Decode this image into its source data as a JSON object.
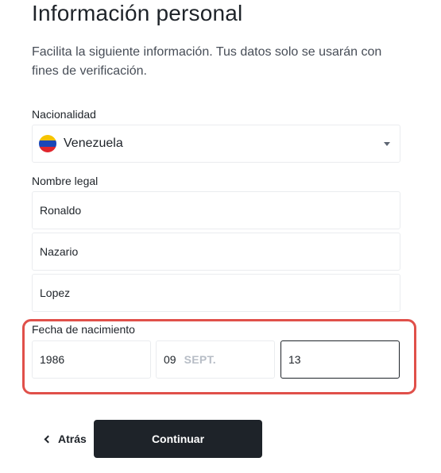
{
  "title": "Información personal",
  "subtitle": "Facilita la siguiente información. Tus datos solo se usarán con fines de verificación.",
  "nationality": {
    "label": "Nacionalidad",
    "value": "Venezuela",
    "flag_icon": "venezuela-flag-icon",
    "dropdown_icon": "caret-down-icon"
  },
  "legal_name": {
    "label": "Nombre legal",
    "first_name": "Ronaldo",
    "middle_name": "Nazario",
    "last_name": "Lopez"
  },
  "birth_date": {
    "label": "Fecha de nacimiento",
    "year": "1986",
    "month_number": "09",
    "month_name": "SEPT.",
    "day": "13",
    "highlight_color": "#e0504a"
  },
  "actions": {
    "back_label": "Atrás",
    "continue_label": "Continuar"
  },
  "colors": {
    "text": "#1e2329",
    "border": "#eaecef",
    "button_bg": "#1e2329",
    "button_text": "#ffffff"
  }
}
